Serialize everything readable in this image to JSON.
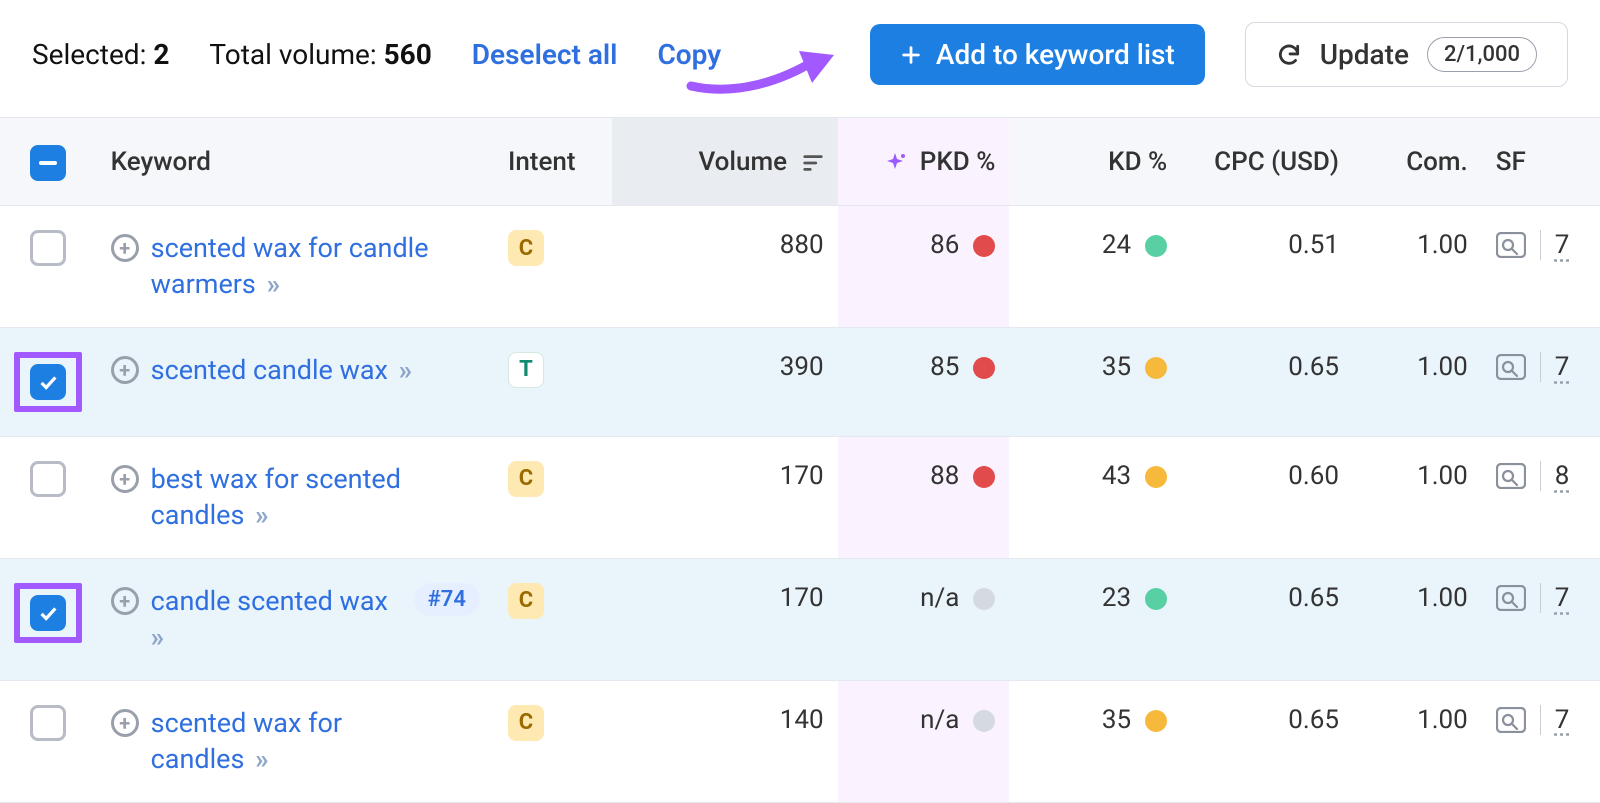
{
  "toolbar": {
    "selected_label": "Selected:",
    "selected_count": "2",
    "volume_label": "Total volume:",
    "volume_value": "560",
    "deselect": "Deselect all",
    "copy": "Copy",
    "add_to_list": "Add to keyword list",
    "update": "Update",
    "update_count": "2/1,000"
  },
  "columns": {
    "keyword": "Keyword",
    "intent": "Intent",
    "volume": "Volume",
    "pkd": "PKD %",
    "kd": "KD %",
    "cpc": "CPC (USD)",
    "com": "Com.",
    "sf": "SF"
  },
  "rows": [
    {
      "checked": false,
      "highlight": false,
      "keyword": "scented wax for candle warmers",
      "rank": null,
      "intent": "C",
      "volume": "880",
      "pkd": "86",
      "pkd_dot": "red",
      "kd": "24",
      "kd_dot": "green",
      "cpc": "0.51",
      "com": "1.00",
      "sf": "7"
    },
    {
      "checked": true,
      "highlight": true,
      "keyword": "scented candle wax",
      "rank": null,
      "intent": "T",
      "volume": "390",
      "pkd": "85",
      "pkd_dot": "red",
      "kd": "35",
      "kd_dot": "orange",
      "cpc": "0.65",
      "com": "1.00",
      "sf": "7"
    },
    {
      "checked": false,
      "highlight": false,
      "keyword": "best wax for scented candles",
      "rank": null,
      "intent": "C",
      "volume": "170",
      "pkd": "88",
      "pkd_dot": "red",
      "kd": "43",
      "kd_dot": "orange",
      "cpc": "0.60",
      "com": "1.00",
      "sf": "8"
    },
    {
      "checked": true,
      "highlight": true,
      "keyword": "candle scented wax",
      "rank": "#74",
      "intent": "C",
      "volume": "170",
      "pkd": "n/a",
      "pkd_dot": "grey",
      "kd": "23",
      "kd_dot": "green",
      "cpc": "0.65",
      "com": "1.00",
      "sf": "7"
    },
    {
      "checked": false,
      "highlight": false,
      "keyword": "scented wax for candles",
      "rank": null,
      "intent": "C",
      "volume": "140",
      "pkd": "n/a",
      "pkd_dot": "grey",
      "kd": "35",
      "kd_dot": "orange",
      "cpc": "0.65",
      "com": "1.00",
      "sf": "7"
    }
  ]
}
